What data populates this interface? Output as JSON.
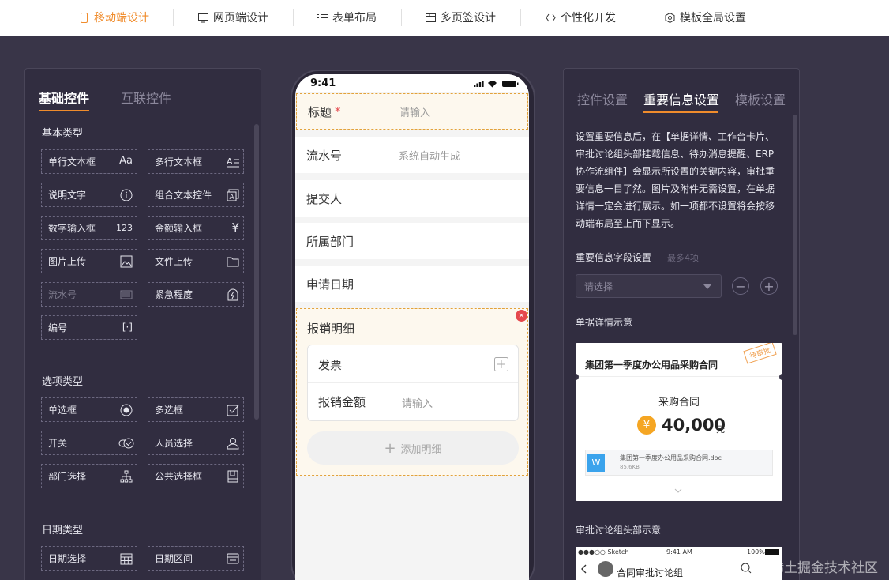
{
  "topbar": {
    "tabs": [
      {
        "label": "移动端设计",
        "icon": "mobile-icon"
      },
      {
        "label": "网页端设计",
        "icon": "monitor-icon"
      },
      {
        "label": "表单布局",
        "icon": "list-icon"
      },
      {
        "label": "多页签设计",
        "icon": "tabs-icon"
      },
      {
        "label": "个性化开发",
        "icon": "code-icon"
      },
      {
        "label": "模板全局设置",
        "icon": "settings-icon"
      }
    ]
  },
  "left": {
    "tabs": [
      "基础控件",
      "互联控件"
    ],
    "sections": [
      "基本类型",
      "选项类型",
      "日期类型"
    ],
    "basic": [
      {
        "label": "单行文本框",
        "icon": "Aa"
      },
      {
        "label": "多行文本框",
        "icon": "multiline-text-icon"
      },
      {
        "label": "说明文字",
        "icon": "info-icon"
      },
      {
        "label": "组合文本控件",
        "icon": "combo-text-icon"
      },
      {
        "label": "数字输入框",
        "icon": "123"
      },
      {
        "label": "金额输入框",
        "icon": "¥"
      },
      {
        "label": "图片上传",
        "icon": "image-icon"
      },
      {
        "label": "文件上传",
        "icon": "folder-icon"
      },
      {
        "label": "流水号",
        "icon": "barcode-icon"
      },
      {
        "label": "紧急程度",
        "icon": "urgency-icon"
      },
      {
        "label": "编号",
        "icon": "[·]"
      }
    ],
    "options": [
      {
        "label": "单选框",
        "icon": "radio-icon"
      },
      {
        "label": "多选框",
        "icon": "checkbox-icon"
      },
      {
        "label": "开关",
        "icon": "switch-icon"
      },
      {
        "label": "人员选择",
        "icon": "person-icon"
      },
      {
        "label": "部门选择",
        "icon": "org-tree-icon"
      },
      {
        "label": "公共选择框",
        "icon": "book-icon"
      }
    ],
    "dates": [
      {
        "label": "日期选择",
        "icon": "calendar-icon"
      },
      {
        "label": "日期区间",
        "icon": "date-range-icon"
      }
    ]
  },
  "phone": {
    "time": "9:41",
    "fields": [
      {
        "label": "标题",
        "required_mark": "*",
        "placeholder": "请输入"
      },
      {
        "label": "流水号",
        "placeholder": "系统自动生成"
      },
      {
        "label": "提交人",
        "placeholder": ""
      },
      {
        "label": "所属部门",
        "placeholder": ""
      },
      {
        "label": "申请日期",
        "placeholder": ""
      }
    ],
    "detail": {
      "title": "报销明细",
      "rows": [
        {
          "label": "发票",
          "placeholder": ""
        },
        {
          "label": "报销金额",
          "placeholder": "请输入"
        }
      ],
      "add_label": "添加明细"
    }
  },
  "right": {
    "tabs": [
      "控件设置",
      "重要信息设置",
      "模板设置"
    ],
    "description": "设置重要信息后，在【单据详情、工作台卡片、审批讨论组头部挂载信息、待办消息提醒、ERP协作流组件】会显示所设置的关键内容，审批重要信息一目了然。图片及附件无需设置，在单据详情一定会进行展示。如一项都不设置将会按移动端布局至上而下显示。",
    "field_setting_label": "重要信息字段设置",
    "field_setting_hint": "最多4项",
    "select_placeholder": "请选择",
    "detail_demo_label": "单据详情示意",
    "discussion_demo_label": "审批讨论组头部示意",
    "demo_card": {
      "title": "集团第一季度办公用品采购合同",
      "stamp": "待审批",
      "subtitle": "采购合同",
      "amount": "40,000",
      "unit": "元",
      "currency_icon": "¥",
      "file_badge": "W",
      "file_name": "集团第一季度办公用品采购合同.doc",
      "file_size": "85.6KB"
    },
    "demo_discussion": {
      "carrier": "●●●○○ Sketch",
      "time": "9:41 AM",
      "battery": "100%",
      "title": "合同审批讨论组"
    }
  },
  "watermark": "@稀土掘金技术社区",
  "colors": {
    "accent": "#f08c2c",
    "required": "#e5484d",
    "panel": "#312d40",
    "background": "#393548"
  }
}
